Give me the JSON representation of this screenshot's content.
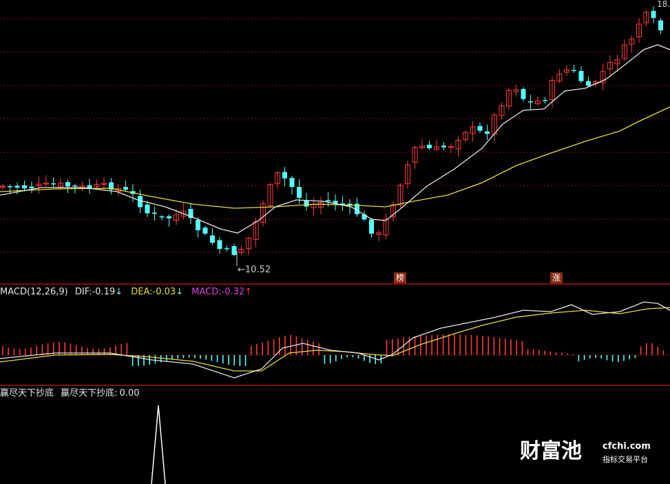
{
  "top_right_price": "18.",
  "low_marker": "10.52",
  "badges": {
    "b1": "榜",
    "b2": "涨"
  },
  "macd": {
    "name": "MACD(12,26,9)",
    "dif_label": "DIF:",
    "dif_value": "-0.19",
    "dif_arrow": "↓",
    "dea_label": "DEA:",
    "dea_value": "-0.03",
    "dea_arrow": "↓",
    "macd_label": "MACD:",
    "macd_value": "-0.32",
    "macd_arrow": "↑"
  },
  "indicator": {
    "name": "赢尽天下抄底",
    "name2": "赢尽天下抄底:",
    "value": "0.00"
  },
  "watermark": {
    "brand": "财富池",
    "domain": "cfchi.com",
    "slogan": "指标交易平台"
  },
  "colors": {
    "up": "#ff3b3b",
    "down": "#54ffff",
    "ma_short": "#e8e8e8",
    "ma_long": "#e8e030",
    "grid": "#8a1010",
    "dea": "#e8e030",
    "macd": "#e040e0"
  }
}
